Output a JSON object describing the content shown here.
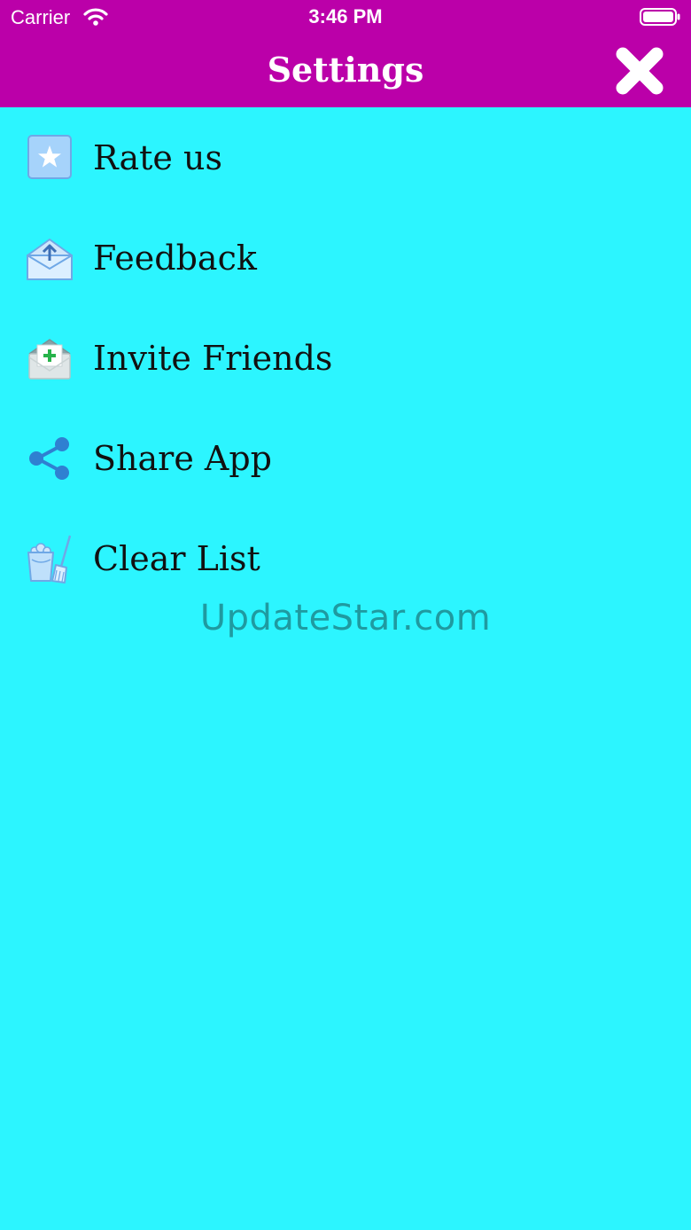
{
  "status_bar": {
    "carrier": "Carrier",
    "time": "3:46 PM"
  },
  "header": {
    "title": "Settings",
    "close_icon": "close-icon",
    "background": "#bb00a9"
  },
  "menu": {
    "items": [
      {
        "label": "Rate us",
        "icon": "star-icon"
      },
      {
        "label": "Feedback",
        "icon": "mail-upload-icon"
      },
      {
        "label": "Invite Friends",
        "icon": "invite-envelope-icon"
      },
      {
        "label": "Share App",
        "icon": "share-icon"
      },
      {
        "label": "Clear List",
        "icon": "bucket-broom-icon"
      }
    ]
  },
  "watermark": "UpdateStar.com",
  "colors": {
    "background": "#2cf5ff",
    "header": "#bb00a9",
    "text": "#111111"
  }
}
